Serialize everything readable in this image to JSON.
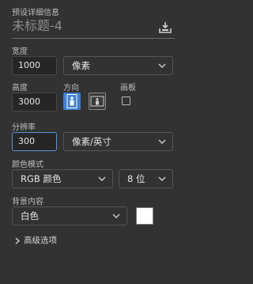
{
  "preset": {
    "section_title": "预设详细信息",
    "document_name": "未标题-4"
  },
  "width": {
    "label": "宽度",
    "value": "1000",
    "unit": "像素"
  },
  "height": {
    "label": "高度",
    "value": "3000"
  },
  "orientation": {
    "label": "方向"
  },
  "artboard": {
    "label": "画板"
  },
  "resolution": {
    "label": "分辨率",
    "value": "300",
    "unit": "像素/英寸"
  },
  "color_mode": {
    "label": "颜色模式",
    "mode": "RGB 颜色",
    "bit_depth": "8 位"
  },
  "background": {
    "label": "背景内容",
    "value": "白色",
    "swatch_color": "#ffffff"
  },
  "advanced": {
    "label": "高级选项"
  },
  "colors": {
    "accent": "#3f7fcf",
    "focus_border": "#5c93d8",
    "panel_bg": "#323232"
  }
}
